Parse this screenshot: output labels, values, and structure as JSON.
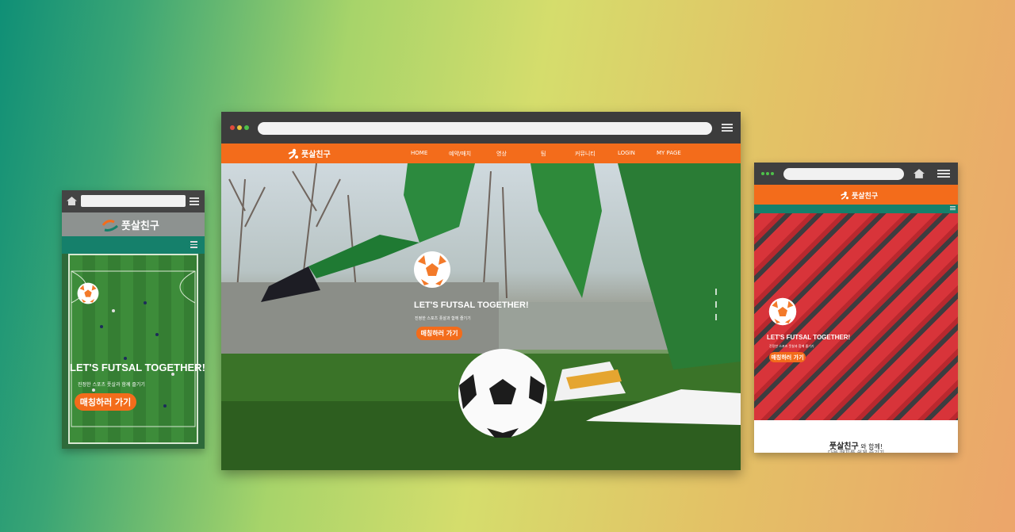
{
  "brand": {
    "name": "풋살친구",
    "accent": "#f36c1b",
    "green": "#15806b"
  },
  "desktop": {
    "nav": [
      "HOME",
      "예약/매치",
      "영상",
      "팀",
      "커뮤니티",
      "LOGIN",
      "MY PAGE"
    ],
    "hero": {
      "title": "LET'S FUTSAL TOGETHER!",
      "subtitle": "진정한 스포츠 풋살과 함께 즐기기",
      "button": "매칭하러 가기"
    }
  },
  "mobile": {
    "hero": {
      "title": "LET'S FUTSAL TOGETHER!",
      "subtitle": "진정한 스포츠 풋살과 함께 즐기기",
      "button": "매칭하러 가기"
    }
  },
  "tablet": {
    "hero": {
      "title": "LET'S FUTSAL TOGETHER!",
      "subtitle": "진정한 스포츠 풋살과 함께 즐기기",
      "button": "매칭하러 가기"
    },
    "section_brand": "풋살친구",
    "section_title_suffix": " 와 함께!",
    "section_subtitle": "다음 매치를 쉽게 즐기기"
  },
  "icons": [
    "home-icon",
    "hamburger-menu-icon",
    "soccer-ball-icon",
    "logo-runner-icon"
  ]
}
